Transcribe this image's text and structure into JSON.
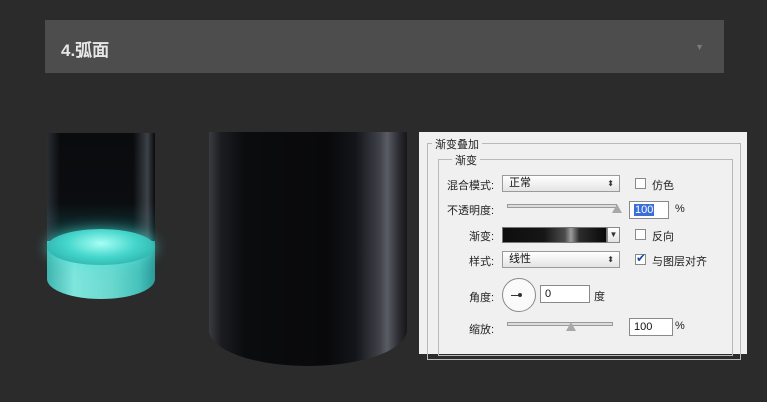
{
  "header": {
    "title": "4.弧面",
    "chevron_icon": "chevron-down-icon"
  },
  "panel": {
    "title": "渐变叠加",
    "section": "渐变",
    "blend_mode": {
      "label": "混合模式:",
      "value": "正常"
    },
    "dither": {
      "label": "仿色",
      "checked": false
    },
    "opacity": {
      "label": "不透明度:",
      "value": "100",
      "unit": "%",
      "level": 1.0
    },
    "gradient": {
      "label": "渐变:"
    },
    "reverse": {
      "label": "反向",
      "checked": false
    },
    "style": {
      "label": "样式:",
      "value": "线性"
    },
    "align": {
      "label": "与图层对齐",
      "checked": true
    },
    "angle": {
      "label": "角度:",
      "value": "0",
      "unit": "度"
    },
    "scale": {
      "label": "缩放:",
      "value": "100",
      "unit": "%",
      "level": 0.6
    }
  }
}
